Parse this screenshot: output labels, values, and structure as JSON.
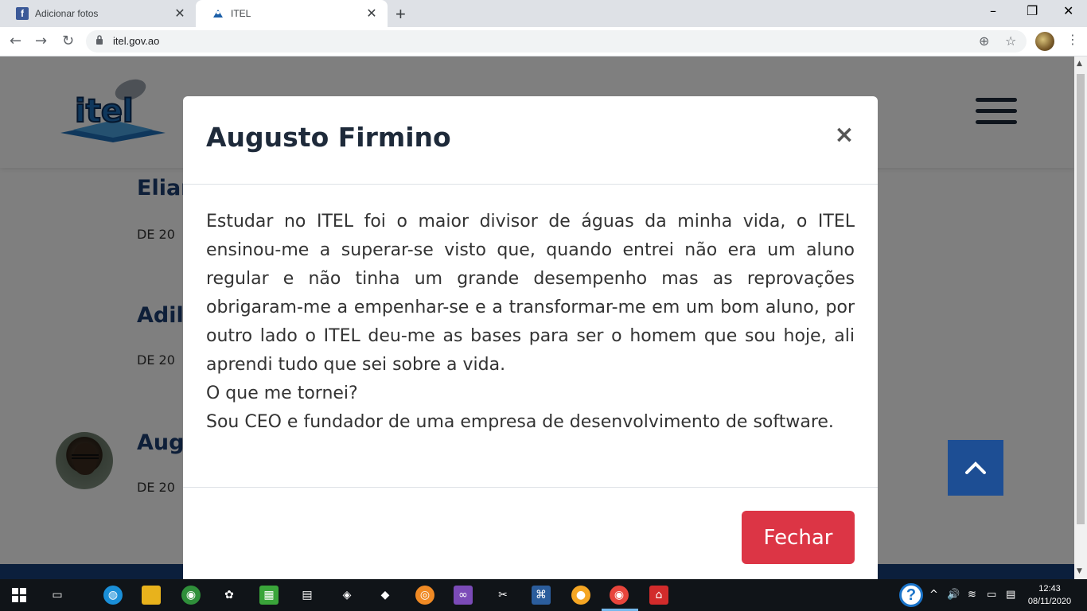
{
  "browser": {
    "tabs": [
      {
        "title": "Adicionar fotos",
        "favicon": "facebook-icon"
      },
      {
        "title": "ITEL",
        "favicon": "itel-icon"
      }
    ],
    "url": "itel.gov.ao"
  },
  "page": {
    "testimonials": [
      {
        "name": "Elian",
        "date": "DE 20"
      },
      {
        "name": "Adils",
        "date": "DE 20"
      },
      {
        "name": "Aug",
        "date": "DE 20"
      }
    ]
  },
  "modal": {
    "title": "Augusto Firmino",
    "close_symbol": "×",
    "body": [
      "Estudar no ITEL foi o maior divisor de águas da minha vida, o ITEL ensinou-me a superar-se visto que, quando entrei não era um aluno regular e não tinha um grande desempenho mas as reprovações obrigaram-me a empenhar-se e a transformar-me em um bom aluno, por outro lado o ITEL deu-me as bases para ser o homem que sou hoje, ali aprendi tudo que sei sobre a vida.",
      "O que me tornei?",
      "Sou CEO e fundador de uma empresa de desenvolvimento de software."
    ],
    "button_label": "Fechar"
  },
  "taskbar": {
    "time": "12:43",
    "date": "08/11/2020"
  },
  "colors": {
    "brand_blue": "#1c3e72",
    "close_red": "#dc3545",
    "back_to_top": "#1d4e94"
  }
}
